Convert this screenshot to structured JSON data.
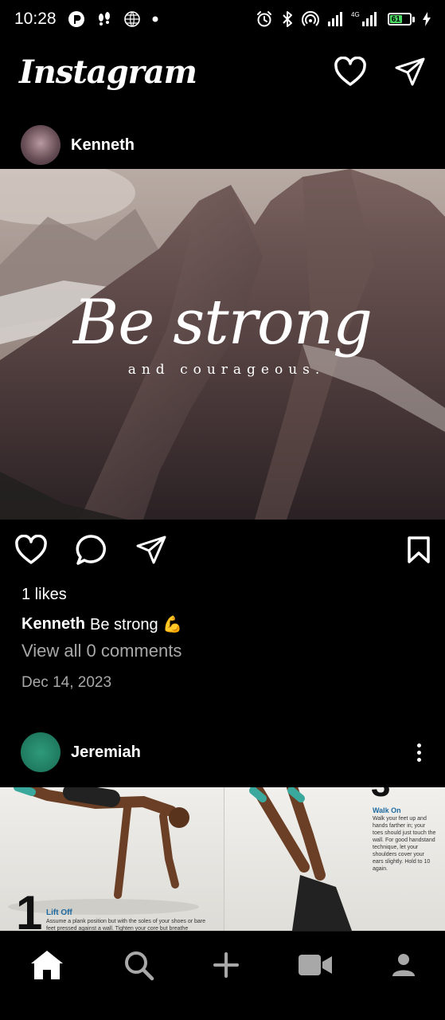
{
  "status_bar": {
    "time": "10:28",
    "battery_percent": "61",
    "network_label": "4G"
  },
  "app": {
    "title": "Instagram"
  },
  "posts": [
    {
      "username": "Kenneth",
      "image": {
        "headline": "Be strong",
        "subline": "and courageous."
      },
      "likes": "1 likes",
      "caption_user": "Kenneth",
      "caption_text": "Be strong 💪",
      "view_comments": "View all 0 comments",
      "date": "Dec 14, 2023"
    },
    {
      "username": "Jeremiah",
      "image": {
        "left_step_number": "1",
        "left_step_title": "Lift Off",
        "left_step_text": "Assume a plank position but with the soles of your shoes or bare feet pressed against a wall. Tighten your core but breathe",
        "right_step_title": "Walk On",
        "right_step_text": "Walk your feet up and hands farther in; your toes should just touch the wall. For good handstand technique, let your shoulders cover your ears slightly. Hold to 10 again."
      }
    }
  ],
  "bottom_nav": {
    "items": [
      "home",
      "search",
      "create",
      "reels",
      "profile"
    ]
  },
  "colors": {
    "background": "#000000",
    "text_secondary": "#a8a8a8",
    "battery": "#4cd964"
  }
}
